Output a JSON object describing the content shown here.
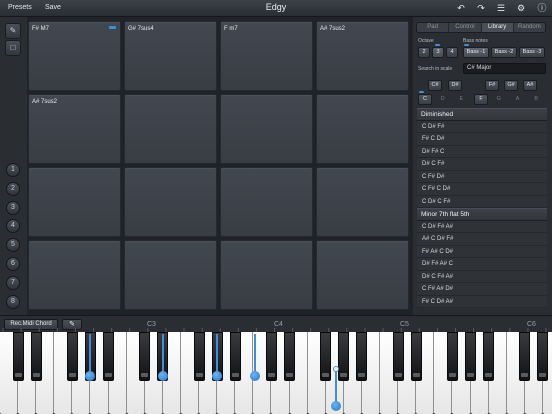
{
  "toolbar": {
    "presets_label": "Presets",
    "save_label": "Save",
    "title": "Edgy"
  },
  "pads": [
    {
      "label": "F# M7",
      "active": true
    },
    {
      "label": "G# 7sus4",
      "active": false
    },
    {
      "label": "F m7",
      "active": false
    },
    {
      "label": "A# 7sus2",
      "active": false
    },
    {
      "label": "A# 7sus2",
      "active": false
    },
    {
      "label": "",
      "active": false
    },
    {
      "label": "",
      "active": false
    },
    {
      "label": "",
      "active": false
    },
    {
      "label": "",
      "active": false
    },
    {
      "label": "",
      "active": false
    },
    {
      "label": "",
      "active": false
    },
    {
      "label": "",
      "active": false
    },
    {
      "label": "",
      "active": false
    },
    {
      "label": "",
      "active": false
    },
    {
      "label": "",
      "active": false
    },
    {
      "label": "",
      "active": false
    }
  ],
  "banks": [
    "1",
    "2",
    "3",
    "4",
    "5",
    "6",
    "7",
    "8"
  ],
  "panel": {
    "tabs": [
      "Pad",
      "Control",
      "Library",
      "Random"
    ],
    "active_tab": "Library",
    "octave_label": "Octave",
    "octave_options": [
      "2",
      "3",
      "4"
    ],
    "octave_selected": "3",
    "bass_label": "Bass notes",
    "bass_options": [
      "Bass -1",
      "Bass -2",
      "Bass -3"
    ],
    "bass_selected": "Bass -1",
    "search_label": "Search in scale",
    "search_value": "C# Major",
    "sharp_keys": [
      "C#",
      "D#",
      "F#",
      "G#",
      "A#"
    ],
    "natural_keys": [
      "C",
      "D",
      "E",
      "F",
      "G",
      "A",
      "B"
    ],
    "selected_natural_keys": [
      "C",
      "F"
    ]
  },
  "library": {
    "groups": [
      {
        "name": "Diminished",
        "chords": [
          "C D# F#",
          "F# C D#",
          "D# F# C",
          "D# C F#",
          "C F# D#",
          "C F# C D#",
          "C D# C F#"
        ]
      },
      {
        "name": "Minor 7th flat 5th",
        "chords": [
          "C D# F# A#",
          "A# C D# F#",
          "F# A# C D#",
          "D# F# A# C",
          "D# C F# A#",
          "C F# A# D#",
          "F# C D# A#"
        ]
      }
    ]
  },
  "keyboard": {
    "rec_label": "Rec.Midi Chord",
    "octave_labels": [
      "C3",
      "C4",
      "C5",
      "C6"
    ]
  },
  "colors": {
    "accent": "#3a8fe0",
    "background": "#1f2226",
    "pad": "#3d4249"
  }
}
